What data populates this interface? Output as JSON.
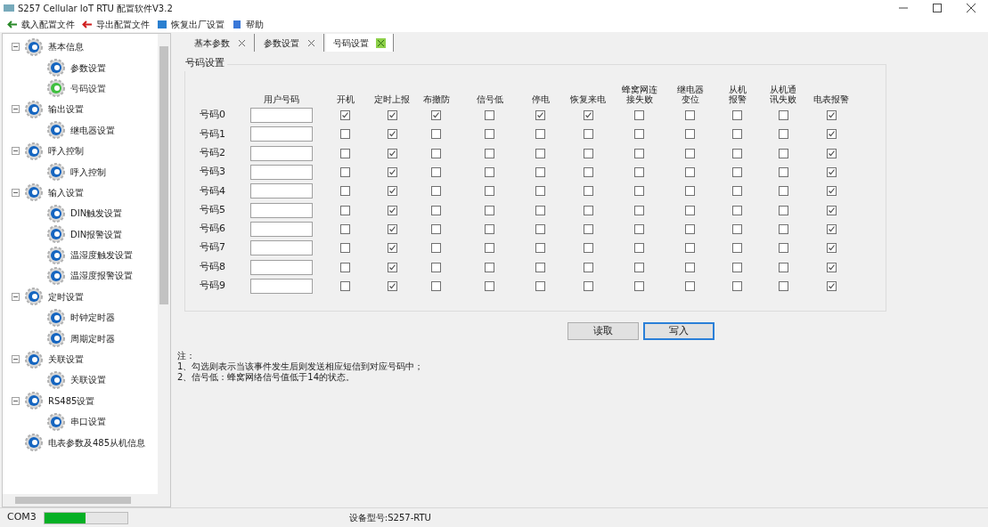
{
  "window": {
    "title": "S257 Cellular IoT RTU 配置软件V3.2"
  },
  "toolbar": [
    "载入配置文件",
    "导出配置文件",
    "恢复出厂设置",
    "帮助"
  ],
  "sidebar": {
    "tree": [
      {
        "label": "基本信息",
        "expanded": true,
        "selected": false,
        "children": [
          {
            "label": "参数设置",
            "selected": false
          },
          {
            "label": "号码设置",
            "selected": true
          }
        ]
      },
      {
        "label": "输出设置",
        "expanded": true,
        "selected": false,
        "children": [
          {
            "label": "继电器设置",
            "selected": false
          }
        ]
      },
      {
        "label": "呼入控制",
        "expanded": true,
        "selected": false,
        "children": [
          {
            "label": "呼入控制",
            "selected": false
          }
        ]
      },
      {
        "label": "输入设置",
        "expanded": true,
        "selected": false,
        "children": [
          {
            "label": "DIN触发设置",
            "selected": false
          },
          {
            "label": "DIN报警设置",
            "selected": false
          },
          {
            "label": "温湿度触发设置",
            "selected": false
          },
          {
            "label": "温湿度报警设置",
            "selected": false
          }
        ]
      },
      {
        "label": "定时设置",
        "expanded": true,
        "selected": false,
        "children": [
          {
            "label": "时钟定时器",
            "selected": false
          },
          {
            "label": "周期定时器",
            "selected": false
          }
        ]
      },
      {
        "label": "关联设置",
        "expanded": true,
        "selected": false,
        "children": [
          {
            "label": "关联设置",
            "selected": false
          }
        ]
      },
      {
        "label": "RS485设置",
        "expanded": true,
        "selected": false,
        "children": [
          {
            "label": "串口设置",
            "selected": false
          }
        ]
      },
      {
        "label": "电表参数及485从机信息",
        "expanded": false,
        "selected": false
      }
    ]
  },
  "tabs": [
    {
      "label": "基本参数",
      "selected": false
    },
    {
      "label": "参数设置",
      "selected": false
    },
    {
      "label": "号码设置",
      "selected": true
    }
  ],
  "group": {
    "title": "号码设置",
    "columns": [
      {
        "label": "用户号码",
        "wrapped": false
      },
      {
        "label": "开机",
        "wrapped": false
      },
      {
        "label": "定时上报",
        "wrapped": false
      },
      {
        "label": "布撤防",
        "wrapped": false
      },
      {
        "label": "信号低",
        "wrapped": false
      },
      {
        "label": "停电",
        "wrapped": false
      },
      {
        "label": "恢复来电",
        "wrapped": false
      },
      {
        "label": "蜂窝网连接失败",
        "wrapped": true
      },
      {
        "label": "继电器变位",
        "wrapped": true
      },
      {
        "label": "从机报警",
        "wrapped": true
      },
      {
        "label": "从机通讯失败",
        "wrapped": true
      },
      {
        "label": "电表报警",
        "wrapped": false
      }
    ],
    "rows": [
      {
        "label": "号码0",
        "checks": [
          true,
          true,
          true,
          false,
          true,
          true,
          false,
          false,
          false,
          false,
          true
        ]
      },
      {
        "label": "号码1",
        "checks": [
          false,
          true,
          false,
          false,
          false,
          false,
          false,
          false,
          false,
          false,
          true
        ]
      },
      {
        "label": "号码2",
        "checks": [
          false,
          true,
          false,
          false,
          false,
          false,
          false,
          false,
          false,
          false,
          true
        ]
      },
      {
        "label": "号码3",
        "checks": [
          false,
          true,
          false,
          false,
          false,
          false,
          false,
          false,
          false,
          false,
          true
        ]
      },
      {
        "label": "号码4",
        "checks": [
          false,
          true,
          false,
          false,
          false,
          false,
          false,
          false,
          false,
          false,
          true
        ]
      },
      {
        "label": "号码5",
        "checks": [
          false,
          true,
          false,
          false,
          false,
          false,
          false,
          false,
          false,
          false,
          true
        ]
      },
      {
        "label": "号码6",
        "checks": [
          false,
          true,
          false,
          false,
          false,
          false,
          false,
          false,
          false,
          false,
          true
        ]
      },
      {
        "label": "号码7",
        "checks": [
          false,
          true,
          false,
          false,
          false,
          false,
          false,
          false,
          false,
          false,
          true
        ]
      },
      {
        "label": "号码8",
        "checks": [
          false,
          true,
          false,
          false,
          false,
          false,
          false,
          false,
          false,
          false,
          true
        ]
      },
      {
        "label": "号码9",
        "checks": [
          false,
          true,
          false,
          false,
          false,
          false,
          false,
          false,
          false,
          false,
          true
        ]
      }
    ]
  },
  "buttons": [
    {
      "label": "读取",
      "focused": false
    },
    {
      "label": "写入",
      "focused": true
    }
  ],
  "notes": [
    "注：",
    "1、勾选则表示当该事件发生后则发送相应短信到对应号码中；",
    "2、信号低：蜂窝网络信号值低于14的状态。"
  ],
  "status_bar": {
    "port": "COM3",
    "progress": {
      "level": 0.5
    },
    "device": "设备型号:S257-RTU"
  }
}
